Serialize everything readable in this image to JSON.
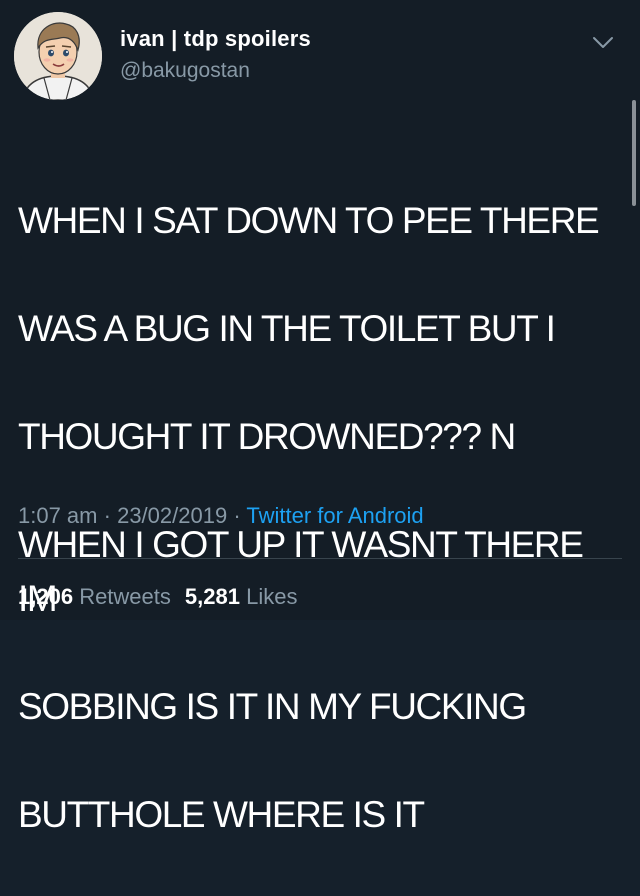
{
  "author": {
    "display_name": "ivan | tdp spoilers",
    "handle": "@bakugostan",
    "avatar_icon": "user-avatar"
  },
  "tweet": {
    "text_lines": [
      "WHEN I SAT DOWN TO PEE THERE",
      "WAS A BUG IN THE TOILET BUT I",
      "THOUGHT IT DROWNED??? N",
      "WHEN I GOT UP IT WASNT THERE IM",
      "SOBBING IS IT IN MY FUCKING",
      "BUTTHOLE WHERE IS IT"
    ],
    "time": "1:07 am",
    "date": "23/02/2019",
    "separator": "·",
    "source": "Twitter for Android"
  },
  "stats": {
    "retweets_count": "1,206",
    "retweets_label": "Retweets",
    "likes_count": "5,281",
    "likes_label": "Likes"
  },
  "colors": {
    "background": "#141d26",
    "text": "#ffffff",
    "muted": "#8899a6",
    "link": "#1da1f2",
    "divider": "#38444d"
  }
}
